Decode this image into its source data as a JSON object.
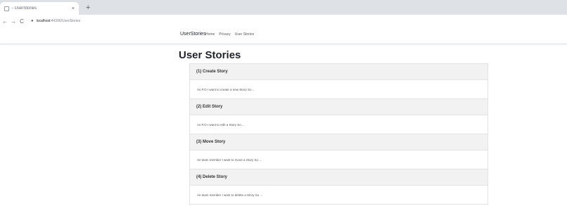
{
  "browser": {
    "tab_title": "- UserStories",
    "tab_close": "×",
    "new_tab": "+",
    "back": "←",
    "forward": "→",
    "reload": "C",
    "url_host": "localhost:",
    "url_path": "44396/UserStories"
  },
  "navbar": {
    "brand": "UserStories",
    "links": [
      "Home",
      "Privacy",
      "User Stories"
    ]
  },
  "page_title": "User Stories",
  "stories": [
    {
      "header": "(1) Create Story",
      "body": "As P.O I want to create a new Story So ..."
    },
    {
      "header": "(2) Edit Story",
      "body": "As P.O I want to edit a Story So ..."
    },
    {
      "header": "(3) Move Story",
      "body": "As team member I want to move a Story So ..."
    },
    {
      "header": "(4) Delete Story",
      "body": "As team member I want to delete a Story So ..."
    }
  ]
}
